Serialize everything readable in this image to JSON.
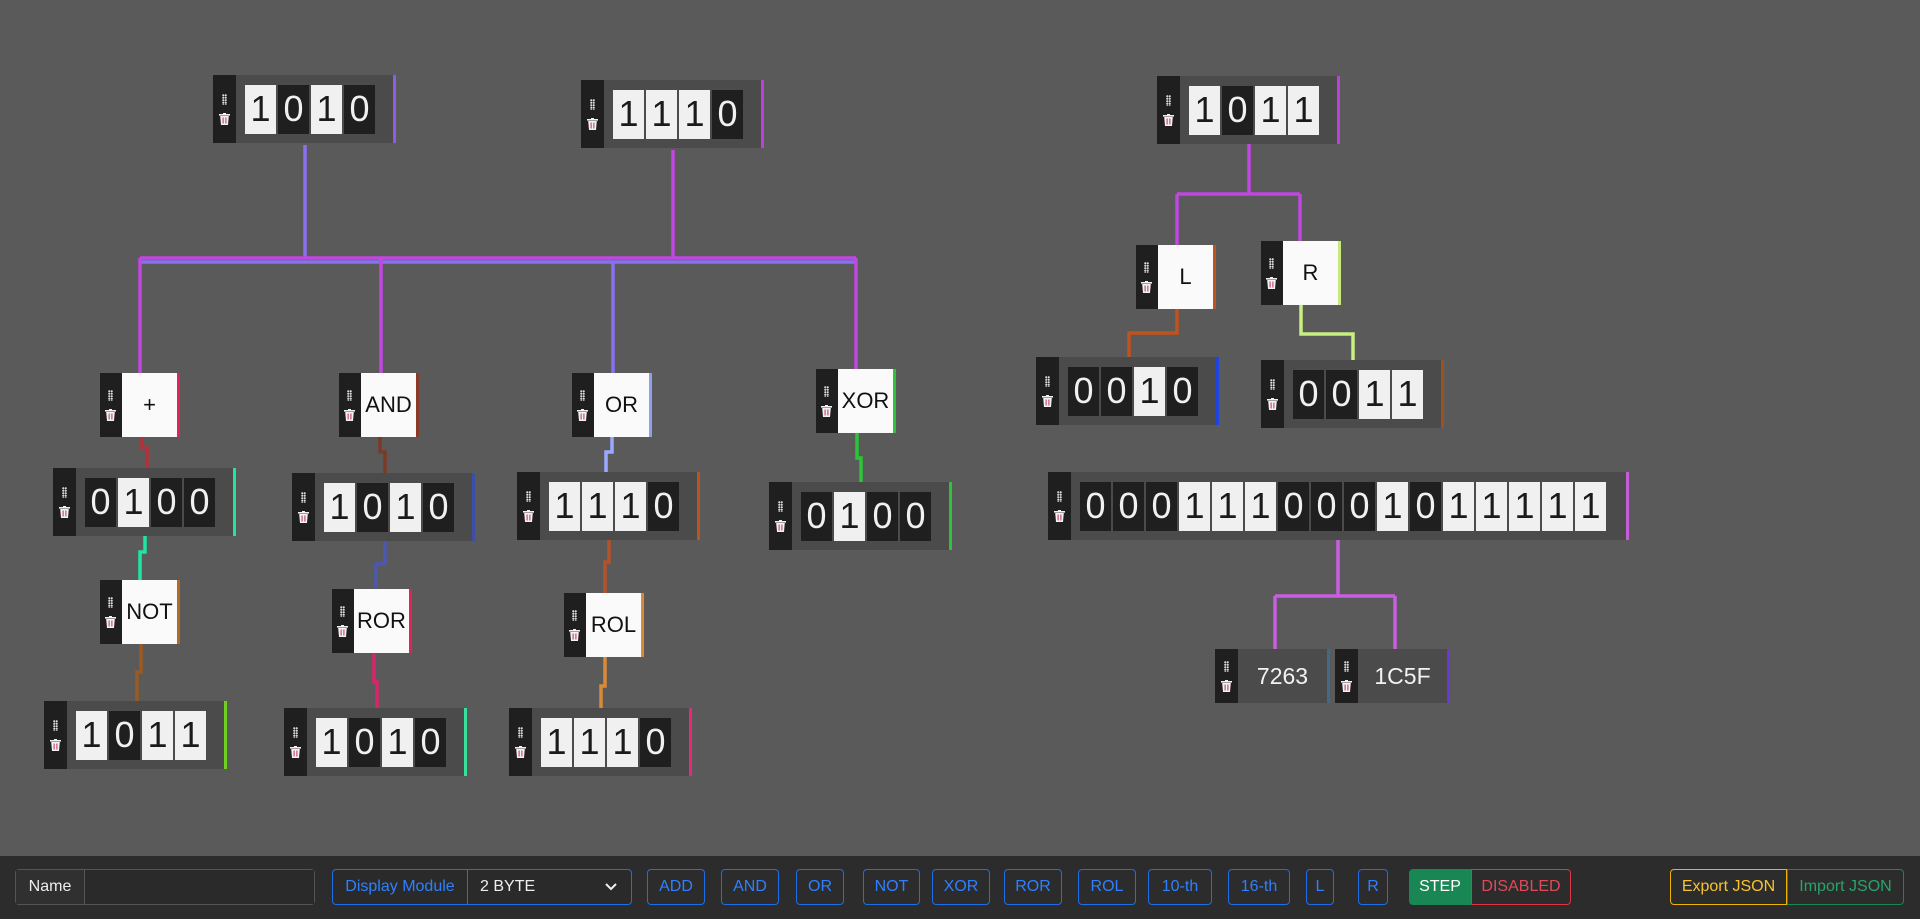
{
  "binary_nodes": [
    {
      "id": "in-a",
      "bits": "1010",
      "accent": "#8a5cf0"
    },
    {
      "id": "in-b",
      "bits": "1110",
      "accent": "#c03ee0"
    },
    {
      "id": "in-c",
      "bits": "1011",
      "accent": "#c03ee0"
    },
    {
      "id": "add-out",
      "bits": "0100",
      "accent": "#20e59a"
    },
    {
      "id": "and-out",
      "bits": "1010",
      "accent": "#3d4ea8"
    },
    {
      "id": "or-out",
      "bits": "1110",
      "accent": "#c0531d"
    },
    {
      "id": "xor-out",
      "bits": "0100",
      "accent": "#2ec43a"
    },
    {
      "id": "not-out",
      "bits": "1011",
      "accent": "#6fcf20"
    },
    {
      "id": "ror-out",
      "bits": "1010",
      "accent": "#39e09b"
    },
    {
      "id": "rol-out",
      "bits": "1110",
      "accent": "#e8287a"
    },
    {
      "id": "l-out",
      "bits": "0010",
      "accent": "#1d43e0"
    },
    {
      "id": "r-out",
      "bits": "0011",
      "accent": "#a0501d"
    },
    {
      "id": "wide",
      "bits": "0001110001011111",
      "accent": "#c45ed8"
    }
  ],
  "operator_nodes": [
    {
      "id": "op-add",
      "label": "+",
      "accent": "#e0245a"
    },
    {
      "id": "op-and",
      "label": "AND",
      "accent": "#8a3a2a"
    },
    {
      "id": "op-or",
      "label": "OR",
      "accent": "#8ea0e8"
    },
    {
      "id": "op-xor",
      "label": "XOR",
      "accent": "#2ec43a"
    },
    {
      "id": "op-not",
      "label": "NOT",
      "accent": "#b56a20"
    },
    {
      "id": "op-ror",
      "label": "ROR",
      "accent": "#e0245a"
    },
    {
      "id": "op-rol",
      "label": "ROL",
      "accent": "#d8893a"
    },
    {
      "id": "op-l",
      "label": "L",
      "accent": "#c0531d"
    },
    {
      "id": "op-r",
      "label": "R",
      "accent": "#c8e87a"
    }
  ],
  "number_nodes": [
    {
      "id": "num-dec",
      "value": "7263",
      "accent": "#3f6a8a"
    },
    {
      "id": "num-hex",
      "value": "1C5F",
      "accent": "#6a3ad0"
    }
  ],
  "wire_colors": {
    "in_a": "#8a6ff0",
    "in_b": "#c048e0",
    "add": "#b52f3a",
    "add_out": "#20e5a0",
    "not": "#9a5a22",
    "and": "#7a3a28",
    "and_out": "#4a58b0",
    "ror": "#d8246a",
    "or": "#9aa8ff",
    "or_out": "#b4522a",
    "rol": "#d8893a",
    "xor": "#2ec43a",
    "in_c": "#c048e0",
    "l": "#c0531d",
    "r": "#c8f080",
    "wide": "#c85ee0"
  },
  "toolbar": {
    "name_label": "Name",
    "name_value": "",
    "display_label": "Display Module",
    "display_selected": "2 BYTE",
    "buttons": [
      "ADD",
      "AND",
      "OR",
      "NOT",
      "XOR",
      "ROR",
      "ROL",
      "10-th",
      "16-th",
      "L",
      "R"
    ],
    "step_label": "STEP",
    "disabled_label": "DISABLED",
    "export_label": "Export JSON",
    "import_label": "Import JSON"
  }
}
